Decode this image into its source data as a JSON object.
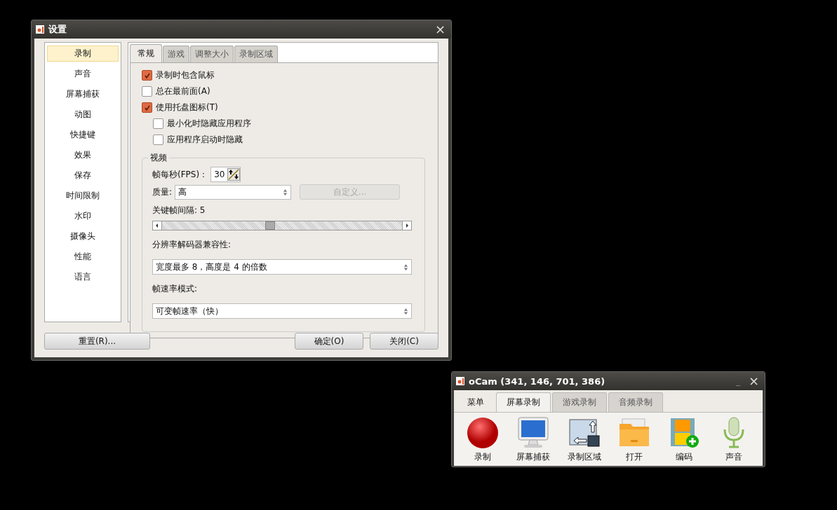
{
  "settings_window": {
    "title": "设置",
    "close": "×",
    "sidebar": {
      "items": [
        {
          "label": "录制",
          "selected": true
        },
        {
          "label": "声音",
          "selected": false
        },
        {
          "label": "屏幕捕获",
          "selected": false
        },
        {
          "label": "动图",
          "selected": false
        },
        {
          "label": "快捷键",
          "selected": false
        },
        {
          "label": "效果",
          "selected": false
        },
        {
          "label": "保存",
          "selected": false
        },
        {
          "label": "时间限制",
          "selected": false
        },
        {
          "label": "水印",
          "selected": false
        },
        {
          "label": "摄像头",
          "selected": false
        },
        {
          "label": "性能",
          "selected": false
        },
        {
          "label": "语言",
          "selected": false
        }
      ]
    },
    "tabs": [
      {
        "label": "常规",
        "selected": true
      },
      {
        "label": "游戏",
        "selected": false
      },
      {
        "label": "调整大小",
        "selected": false
      },
      {
        "label": "录制区域",
        "selected": false
      }
    ],
    "checkboxes": [
      {
        "label": "录制时包含鼠标",
        "checked": true
      },
      {
        "label": "总在最前面(A)",
        "checked": false
      },
      {
        "label": "使用托盘图标(T)",
        "checked": true,
        "children": [
          {
            "label": "最小化时隐藏应用程序",
            "checked": false
          },
          {
            "label": "应用程序启动时隐藏",
            "checked": false
          }
        ]
      }
    ],
    "video": {
      "title": "视频",
      "fps_label": "帧每秒(FPS)：",
      "fps_value": "30",
      "quality_label": "质量:",
      "quality_value": "高",
      "custom_button": {
        "label": "自定义...",
        "disabled": true
      },
      "keyframe_label": "关键帧间隔: 5",
      "keyframe_slider": {
        "level": 0.45
      },
      "codec_label": "分辨率解码器兼容性:",
      "codec_value": "宽度最多 8，高度是 4 的倍数",
      "framerate_label": "帧速率模式:",
      "framerate_value": "可变帧速率（快）"
    },
    "buttons": {
      "reset": "重置(R)...",
      "ok": "确定(O)",
      "close": "关闭(C)"
    }
  },
  "ocam_window": {
    "title": "oCam (341, 146, 701, 386)",
    "minimize": "_",
    "close": "×",
    "tabs": [
      {
        "label": "菜单",
        "selected": false,
        "kind": "plain"
      },
      {
        "label": "屏幕录制",
        "selected": true,
        "kind": "box"
      },
      {
        "label": "游戏录制",
        "selected": false,
        "kind": "box"
      },
      {
        "label": "音频录制",
        "selected": false,
        "kind": "box"
      }
    ],
    "tools": [
      {
        "label": "录制",
        "kind": "record"
      },
      {
        "label": "屏幕捕获",
        "kind": "monitor"
      },
      {
        "label": "录制区域",
        "kind": "region"
      },
      {
        "label": "打开",
        "kind": "folder"
      },
      {
        "label": "编码",
        "kind": "film"
      },
      {
        "label": "声音",
        "kind": "mic"
      }
    ]
  }
}
